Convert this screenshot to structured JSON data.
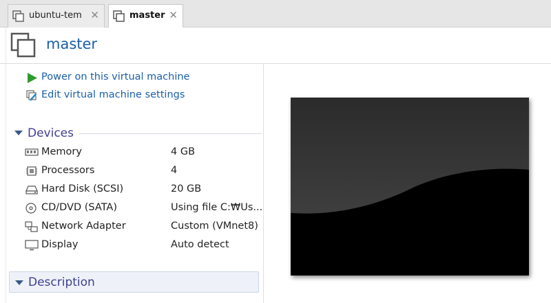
{
  "tabs": [
    {
      "label": "ubuntu-tem",
      "close": "✕",
      "active": false
    },
    {
      "label": "master",
      "close": "✕",
      "active": true
    }
  ],
  "header": {
    "title": "master"
  },
  "actions": [
    {
      "label": "Power on this virtual machine",
      "icon": "play-icon"
    },
    {
      "label": "Edit virtual machine settings",
      "icon": "edit-settings-icon"
    }
  ],
  "devices": {
    "heading": "Devices",
    "items": [
      {
        "name": "Memory",
        "value": "4 GB",
        "icon": "memory-icon"
      },
      {
        "name": "Processors",
        "value": "4",
        "icon": "processor-icon"
      },
      {
        "name": "Hard Disk (SCSI)",
        "value": "20 GB",
        "icon": "hard-disk-icon"
      },
      {
        "name": "CD/DVD (SATA)",
        "value": "Using file C:₩Us...",
        "icon": "cd-dvd-icon"
      },
      {
        "name": "Network Adapter",
        "value": "Custom (VMnet8)",
        "icon": "network-adapter-icon"
      },
      {
        "name": "Display",
        "value": "Auto detect",
        "icon": "display-icon"
      }
    ]
  },
  "description": {
    "heading": "Description"
  },
  "colors": {
    "accent": "#1a5fa8",
    "section": "#3f3f8f",
    "play": "#2e9a2e"
  }
}
